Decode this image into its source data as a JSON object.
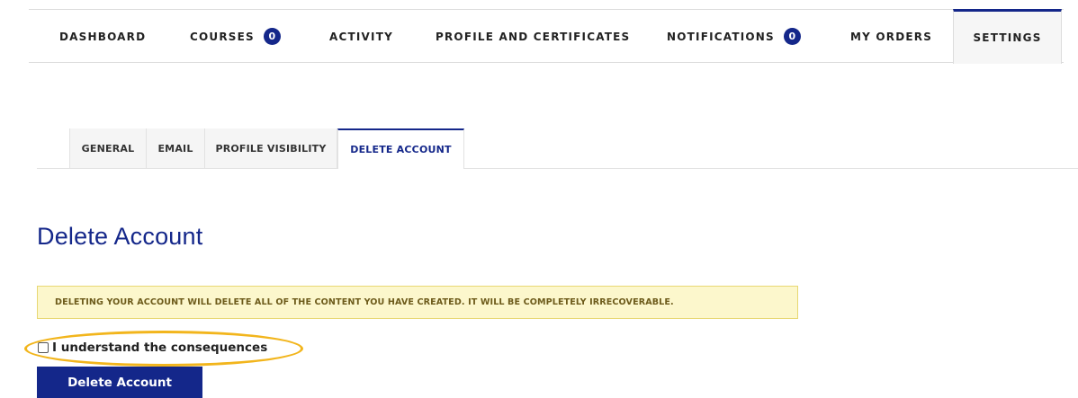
{
  "main_nav": {
    "dashboard": "DASHBOARD",
    "courses": "COURSES",
    "courses_count": "0",
    "activity": "ACTIVITY",
    "profile_certificates": "PROFILE AND CERTIFICATES",
    "notifications": "NOTIFICATIONS",
    "notifications_count": "0",
    "my_orders": "MY ORDERS",
    "settings": "SETTINGS",
    "active": "SETTINGS"
  },
  "sub_tabs": {
    "general": "GENERAL",
    "email": "EMAIL",
    "profile_visibility": "PROFILE VISIBILITY",
    "delete_account": "DELETE ACCOUNT",
    "active": "DELETE ACCOUNT"
  },
  "content": {
    "title": "Delete Account",
    "warning": "DELETING YOUR ACCOUNT WILL DELETE ALL OF THE CONTENT YOU HAVE CREATED. IT WILL BE COMPLETELY IRRECOVERABLE.",
    "confirm_label": "I understand the consequences",
    "confirm_checked": false,
    "delete_button": "Delete Account"
  },
  "colors": {
    "accent": "#14278a",
    "warning_bg": "#fcf7cc",
    "warning_border": "#e8d873",
    "warning_text": "#6d5b1b",
    "highlight": "#f2b51c"
  },
  "icons": {
    "checkbox": "checkbox-icon"
  }
}
